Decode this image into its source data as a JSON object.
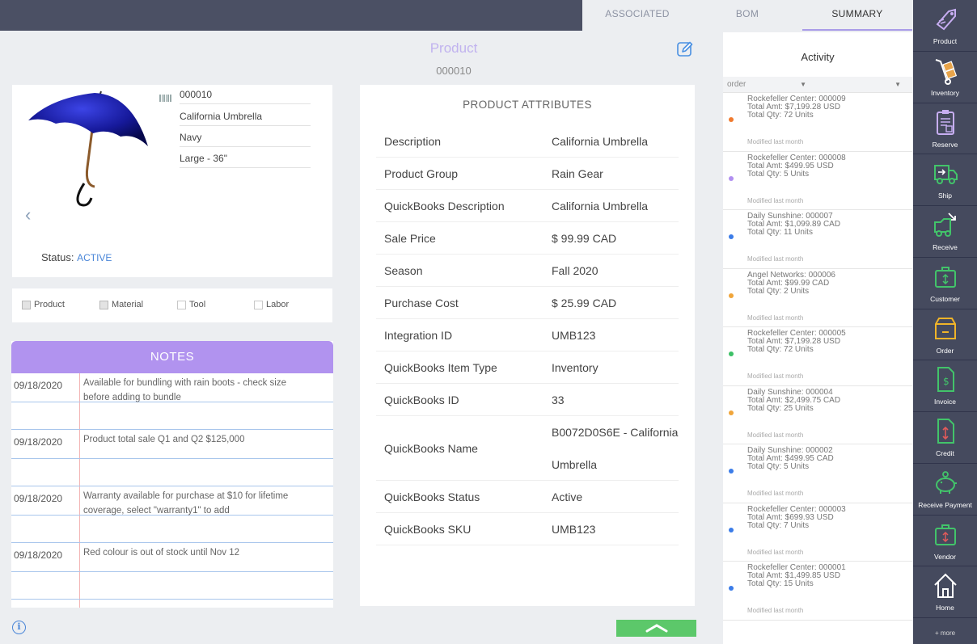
{
  "tabs": [
    {
      "label": "ASSOCIATED"
    },
    {
      "label": "BOM"
    },
    {
      "label": "SUMMARY"
    }
  ],
  "header": {
    "title": "Product",
    "number": "000010"
  },
  "product": {
    "sku": "000010",
    "name": "California Umbrella",
    "color": "Navy",
    "size": "Large - 36\"",
    "status_label": "Status:",
    "status_value": "ACTIVE"
  },
  "types": [
    {
      "label": "Product",
      "checked": true
    },
    {
      "label": "Material",
      "checked": true
    },
    {
      "label": "Tool",
      "checked": false
    },
    {
      "label": "Labor",
      "checked": false
    }
  ],
  "notes": {
    "title": "NOTES",
    "items": [
      {
        "date": "09/18/2020",
        "text": "Available for bundling with rain boots - check size before adding to bundle"
      },
      {
        "date": "09/18/2020",
        "text": "Product total sale Q1 and Q2 $125,000"
      },
      {
        "date": "09/18/2020",
        "text": "Warranty available for purchase at $10 for lifetime coverage, select \"warranty1\" to add"
      },
      {
        "date": "09/18/2020",
        "text": "Red colour is out of stock until Nov 12"
      }
    ]
  },
  "attributes": {
    "title": "PRODUCT ATTRIBUTES",
    "rows": [
      {
        "key": "Description",
        "value": "California Umbrella"
      },
      {
        "key": "Product Group",
        "value": "Rain Gear"
      },
      {
        "key": "QuickBooks Description",
        "value": "California Umbrella"
      },
      {
        "key": "Sale Price",
        "value": "$ 99.99 CAD"
      },
      {
        "key": "Season",
        "value": "Fall 2020"
      },
      {
        "key": "Purchase Cost",
        "value": "$ 25.99 CAD"
      },
      {
        "key": "Integration ID",
        "value": "UMB123"
      },
      {
        "key": "QuickBooks Item Type",
        "value": "Inventory"
      },
      {
        "key": "QuickBooks ID",
        "value": "33"
      },
      {
        "key": "QuickBooks Name",
        "value": "B0072D0S6E - California Umbrella"
      },
      {
        "key": "QuickBooks Status",
        "value": "Active"
      },
      {
        "key": "QuickBooks SKU",
        "value": "UMB123"
      }
    ]
  },
  "activity": {
    "title": "Activity",
    "filter1": "order",
    "filter2": "",
    "items": [
      {
        "line1": "Rockefeller Center: 000009",
        "line2": "Total Amt: $7,199.28 USD",
        "line3": "Total Qty: 72 Units",
        "modified": "Modified last month",
        "dot_color": "#f07a2e"
      },
      {
        "line1": "Rockefeller Center: 000008",
        "line2": "Total Amt: $499.95 USD",
        "line3": "Total Qty: 5 Units",
        "modified": "Modified last month",
        "dot_color": "#b18ff0"
      },
      {
        "line1": "Daily Sunshine: 000007",
        "line2": "Total Amt: $1,099.89 CAD",
        "line3": "Total Qty: 11 Units",
        "modified": "Modified last month",
        "dot_color": "#3b7ce8"
      },
      {
        "line1": "Angel Networks: 000006",
        "line2": "Total Amt: $99.99 CAD",
        "line3": "Total Qty: 2 Units",
        "modified": "Modified last month",
        "dot_color": "#f0a53a"
      },
      {
        "line1": "Rockefeller Center: 000005",
        "line2": "Total Amt: $7,199.28 USD",
        "line3": "Total Qty: 72 Units",
        "modified": "Modified last month",
        "dot_color": "#3cc066"
      },
      {
        "line1": "Daily Sunshine: 000004",
        "line2": "Total Amt: $2,499.75 CAD",
        "line3": "Total Qty: 25 Units",
        "modified": "Modified last month",
        "dot_color": "#f0a53a"
      },
      {
        "line1": "Daily Sunshine: 000002",
        "line2": "Total Amt: $499.95 CAD",
        "line3": "Total Qty: 5 Units",
        "modified": "Modified last month",
        "dot_color": "#3b7ce8"
      },
      {
        "line1": "Rockefeller Center: 000003",
        "line2": "Total Amt: $699.93 USD",
        "line3": "Total Qty: 7 Units",
        "modified": "Modified last month",
        "dot_color": "#3b7ce8"
      },
      {
        "line1": "Rockefeller Center: 000001",
        "line2": "Total Amt: $1,499.85 USD",
        "line3": "Total Qty: 15 Units",
        "modified": "Modified last month",
        "dot_color": "#3b7ce8"
      }
    ]
  },
  "sidebar": {
    "items": [
      {
        "label": "Product",
        "icon": "tag-icon"
      },
      {
        "label": "Inventory",
        "icon": "hand-truck-icon"
      },
      {
        "label": "Reserve",
        "icon": "clipboard-icon"
      },
      {
        "label": "Ship",
        "icon": "truck-ship-icon"
      },
      {
        "label": "Receive",
        "icon": "truck-receive-icon"
      },
      {
        "label": "Customer",
        "icon": "briefcase-icon"
      },
      {
        "label": "Order",
        "icon": "box-icon"
      },
      {
        "label": "Invoice",
        "icon": "invoice-icon"
      },
      {
        "label": "Credit",
        "icon": "credit-icon"
      },
      {
        "label": "Receive Payment",
        "icon": "piggy-bank-icon"
      },
      {
        "label": "Vendor",
        "icon": "vendor-briefcase-icon"
      },
      {
        "label": "Home",
        "icon": "home-icon"
      }
    ],
    "more": "+ more"
  },
  "colors": {
    "accent": "#b193ef",
    "topbar": "#4b5064",
    "sidebar": "#454a5e",
    "sidebar_icon": "#42c46a",
    "status_active": "#4a86d8",
    "scroll_button": "#5cc86a"
  }
}
